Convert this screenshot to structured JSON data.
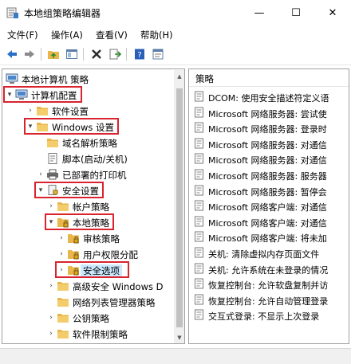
{
  "window": {
    "title": "本地组策略编辑器",
    "minimize_glyph": "—",
    "maximize_glyph": "☐",
    "close_glyph": "✕"
  },
  "menu": [
    {
      "label": "文件(F)"
    },
    {
      "label": "操作(A)"
    },
    {
      "label": "查看(V)"
    },
    {
      "label": "帮助(H)"
    }
  ],
  "toolbar": {
    "icons": [
      "back-arrow-icon",
      "forward-arrow-icon",
      "folder-up-icon",
      "show-hide-tree-icon",
      "delete-icon",
      "export-list-icon",
      "help-icon",
      "properties-icon"
    ]
  },
  "tree": [
    {
      "label": "本地计算机 策略",
      "twisty": "",
      "highlight": false,
      "selected": false
    },
    {
      "label": "计算机配置",
      "twisty": "▾",
      "highlight": true,
      "selected": false
    },
    {
      "label": "软件设置",
      "twisty": "›",
      "highlight": false,
      "selected": false
    },
    {
      "label": "Windows 设置",
      "twisty": "▾",
      "highlight": true,
      "selected": false
    },
    {
      "label": "域名解析策略",
      "twisty": "",
      "highlight": false,
      "selected": false
    },
    {
      "label": "脚本(启动/关机)",
      "twisty": "",
      "highlight": false,
      "selected": false
    },
    {
      "label": "已部署的打印机",
      "twisty": "›",
      "highlight": false,
      "selected": false
    },
    {
      "label": "安全设置",
      "twisty": "▾",
      "highlight": true,
      "selected": false
    },
    {
      "label": "帐户策略",
      "twisty": "›",
      "highlight": false,
      "selected": false
    },
    {
      "label": "本地策略",
      "twisty": "▾",
      "highlight": true,
      "selected": false
    },
    {
      "label": "审核策略",
      "twisty": "›",
      "highlight": false,
      "selected": false
    },
    {
      "label": "用户权限分配",
      "twisty": "›",
      "highlight": false,
      "selected": false
    },
    {
      "label": "安全选项",
      "twisty": "›",
      "highlight": true,
      "selected": true
    },
    {
      "label": "高级安全 Windows D",
      "twisty": "›",
      "highlight": false,
      "selected": false
    },
    {
      "label": "网络列表管理器策略",
      "twisty": "",
      "highlight": false,
      "selected": false
    },
    {
      "label": "公钥策略",
      "twisty": "›",
      "highlight": false,
      "selected": false
    },
    {
      "label": "软件限制策略",
      "twisty": "›",
      "highlight": false,
      "selected": false
    }
  ],
  "policy_list": {
    "header": "策略",
    "rows": [
      {
        "text": "DCOM: 使用安全描述符定义语"
      },
      {
        "text": "Microsoft 网络服务器: 尝试使"
      },
      {
        "text": "Microsoft 网络服务器: 登录时"
      },
      {
        "text": "Microsoft 网络服务器: 对通信"
      },
      {
        "text": "Microsoft 网络服务器: 对通信"
      },
      {
        "text": "Microsoft 网络服务器: 服务器"
      },
      {
        "text": "Microsoft 网络服务器: 暂停会"
      },
      {
        "text": "Microsoft 网络客户端: 对通信"
      },
      {
        "text": "Microsoft 网络客户端: 对通信"
      },
      {
        "text": "Microsoft 网络客户端: 将未加"
      },
      {
        "text": "关机: 清除虚拟内存页面文件"
      },
      {
        "text": "关机: 允许系统在未登录的情况"
      },
      {
        "text": "恢复控制台: 允许软盘复制并访"
      },
      {
        "text": "恢复控制台: 允许自动管理登录"
      },
      {
        "text": "交互式登录: 不显示上次登录"
      }
    ]
  },
  "colors": {
    "highlight_box": "#d9232e",
    "selection": "#cce8ff",
    "folder": "#e8b64a"
  }
}
